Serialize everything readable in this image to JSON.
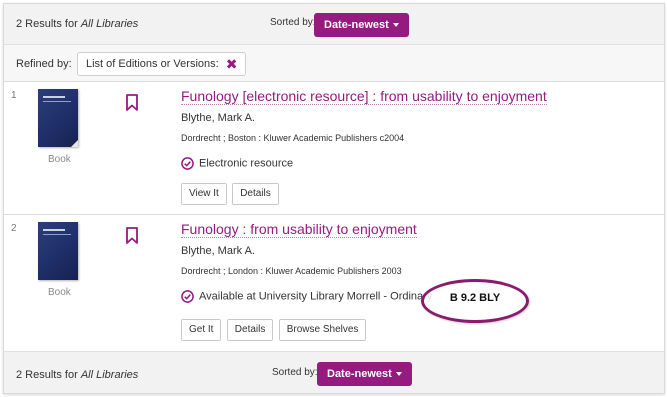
{
  "results_header": {
    "count_text": "2 Results",
    "for_text": "for",
    "scope": "All Libraries",
    "sorted_by_label": "Sorted by:",
    "sort_value": "Date-newest"
  },
  "refine": {
    "label": "Refined by:",
    "facet": "List of Editions or Versions:"
  },
  "results": [
    {
      "number": "1",
      "type": "Book",
      "title": "Funology [electronic resource] : from usability to enjoyment",
      "author": "Blythe, Mark A.",
      "publisher": "Dordrecht ; Boston : Kluwer Academic Publishers c2004",
      "availability": "Electronic resource",
      "buttons": [
        "View It",
        "Details"
      ]
    },
    {
      "number": "2",
      "type": "Book",
      "title": "Funology : from usability to enjoyment",
      "author": "Blythe, Mark A.",
      "publisher": "Dordrecht ; London : Kluwer Academic Publishers 2003",
      "availability": "Available at University Library Morrell - Ordinary",
      "call_number": "B 9.2 BLY",
      "buttons": [
        "Get It",
        "Details",
        "Browse Shelves"
      ]
    }
  ],
  "results_footer": {
    "count_text": "2 Results",
    "for_text": "for",
    "scope": "All Libraries",
    "sorted_by_label": "Sorted by:",
    "sort_value": "Date-newest"
  },
  "colors": {
    "accent": "#951b81",
    "highlight_ring": "#8a1a6e"
  }
}
